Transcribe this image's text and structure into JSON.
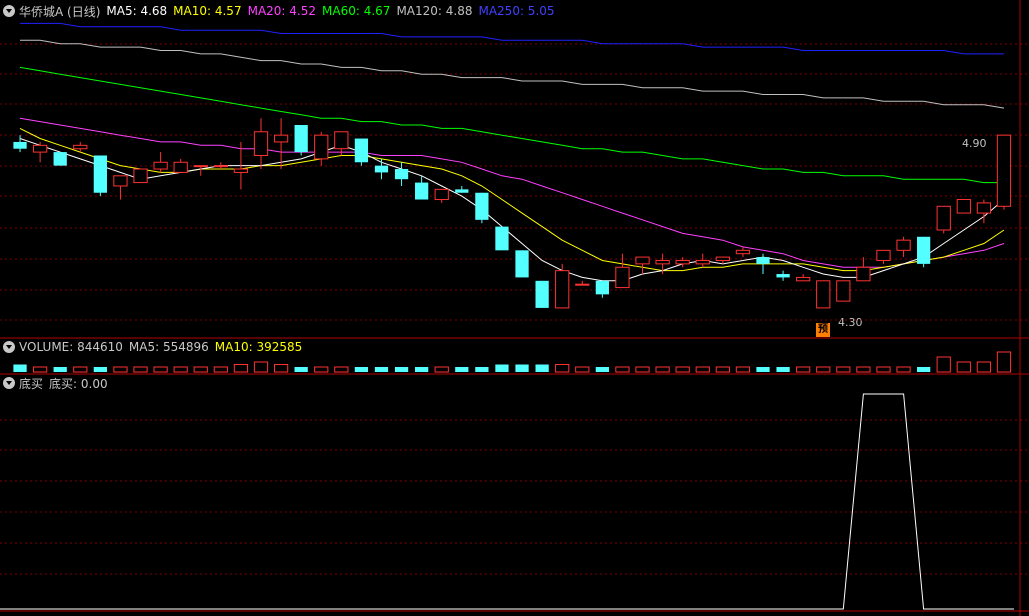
{
  "header": {
    "title": "华侨城A (日线)",
    "ma5": "MA5: 4.68",
    "ma10": "MA10: 4.57",
    "ma20": "MA20: 4.52",
    "ma60": "MA60: 4.67",
    "ma120": "MA120: 4.88",
    "ma250": "MA250: 5.05"
  },
  "volume_header": {
    "label": "VOLUME: 844610",
    "ma5": "MA5: 554896",
    "ma10": "MA10: 392585"
  },
  "indicator_header": {
    "name": "底买",
    "value": "底买: 0.00"
  },
  "annotations": {
    "high_label": "4.90",
    "low_label": "4.30",
    "flag_text": "预"
  },
  "colors": {
    "up": "#ff3232",
    "down": "#54ffff",
    "ma5": "#ffffff",
    "ma10": "#ffff00",
    "ma20": "#ff40ff",
    "ma60": "#00ff00",
    "ma120": "#c0c0c0",
    "ma250": "#2020ff",
    "grid": "#800000",
    "indicator": "#ffffff"
  },
  "chart_data": {
    "type": "candlestick",
    "ylim": [
      4.22,
      5.15
    ],
    "candles": [
      [
        4.79,
        4.81,
        4.76,
        4.77
      ],
      [
        4.76,
        4.79,
        4.73,
        4.78
      ],
      [
        4.76,
        4.76,
        4.72,
        4.72
      ],
      [
        4.77,
        4.79,
        4.76,
        4.78
      ],
      [
        4.75,
        4.75,
        4.63,
        4.64
      ],
      [
        4.66,
        4.69,
        4.62,
        4.69
      ],
      [
        4.67,
        4.71,
        4.68,
        4.71
      ],
      [
        4.71,
        4.76,
        4.7,
        4.73
      ],
      [
        4.7,
        4.74,
        4.7,
        4.73
      ],
      [
        4.72,
        4.72,
        4.69,
        4.72
      ],
      [
        4.72,
        4.73,
        4.71,
        4.72
      ],
      [
        4.7,
        4.79,
        4.65,
        4.71
      ],
      [
        4.75,
        4.86,
        4.71,
        4.82
      ],
      [
        4.79,
        4.86,
        4.71,
        4.81
      ],
      [
        4.84,
        4.84,
        4.75,
        4.76
      ],
      [
        4.74,
        4.82,
        4.72,
        4.81
      ],
      [
        4.77,
        4.8,
        4.75,
        4.82
      ],
      [
        4.8,
        4.8,
        4.72,
        4.73
      ],
      [
        4.72,
        4.74,
        4.68,
        4.7
      ],
      [
        4.71,
        4.73,
        4.66,
        4.68
      ],
      [
        4.67,
        4.69,
        4.62,
        4.62
      ],
      [
        4.62,
        4.63,
        4.61,
        4.65
      ],
      [
        4.65,
        4.66,
        4.64,
        4.64
      ],
      [
        4.64,
        4.64,
        4.55,
        4.56
      ],
      [
        4.54,
        4.54,
        4.49,
        4.47
      ],
      [
        4.47,
        4.47,
        4.39,
        4.39
      ],
      [
        4.38,
        4.38,
        4.3,
        4.3
      ],
      [
        4.3,
        4.43,
        4.3,
        4.41
      ],
      [
        4.37,
        4.38,
        4.37,
        4.37
      ],
      [
        4.38,
        4.38,
        4.33,
        4.34
      ],
      [
        4.36,
        4.46,
        4.36,
        4.42
      ],
      [
        4.43,
        4.44,
        4.4,
        4.45
      ],
      [
        4.43,
        4.46,
        4.4,
        4.44
      ],
      [
        4.43,
        4.45,
        4.42,
        4.44
      ],
      [
        4.43,
        4.46,
        4.42,
        4.44
      ],
      [
        4.44,
        4.45,
        4.43,
        4.45
      ],
      [
        4.46,
        4.48,
        4.45,
        4.47
      ],
      [
        4.45,
        4.46,
        4.4,
        4.43
      ],
      [
        4.4,
        4.41,
        4.38,
        4.39
      ],
      [
        4.38,
        4.4,
        4.38,
        4.39
      ],
      [
        4.3,
        4.33,
        4.3,
        4.38
      ],
      [
        4.32,
        4.38,
        4.32,
        4.38
      ],
      [
        4.38,
        4.45,
        4.38,
        4.42
      ],
      [
        4.44,
        4.47,
        4.43,
        4.47
      ],
      [
        4.47,
        4.51,
        4.45,
        4.5
      ],
      [
        4.51,
        4.51,
        4.42,
        4.43
      ],
      [
        4.53,
        4.6,
        4.52,
        4.6
      ],
      [
        4.58,
        4.62,
        4.58,
        4.62
      ],
      [
        4.58,
        4.62,
        4.55,
        4.61
      ],
      [
        4.6,
        4.69,
        4.59,
        4.81
      ]
    ],
    "ma5": [
      4.8,
      4.78,
      4.76,
      4.74,
      4.72,
      4.7,
      4.68,
      4.69,
      4.7,
      4.71,
      4.72,
      4.72,
      4.72,
      4.73,
      4.74,
      4.76,
      4.78,
      4.76,
      4.73,
      4.71,
      4.69,
      4.66,
      4.63,
      4.59,
      4.54,
      4.49,
      4.44,
      4.41,
      4.39,
      4.38,
      4.38,
      4.4,
      4.41,
      4.43,
      4.44,
      4.43,
      4.44,
      4.45,
      4.44,
      4.42,
      4.4,
      4.39,
      4.39,
      4.41,
      4.43,
      4.45,
      4.49,
      4.53,
      4.57,
      4.62
    ],
    "ma10": [
      4.83,
      4.8,
      4.78,
      4.76,
      4.74,
      4.72,
      4.71,
      4.7,
      4.7,
      4.71,
      4.71,
      4.71,
      4.72,
      4.72,
      4.73,
      4.74,
      4.75,
      4.75,
      4.74,
      4.73,
      4.72,
      4.71,
      4.69,
      4.66,
      4.62,
      4.58,
      4.54,
      4.5,
      4.47,
      4.44,
      4.43,
      4.42,
      4.41,
      4.41,
      4.42,
      4.42,
      4.43,
      4.43,
      4.43,
      4.43,
      4.42,
      4.41,
      4.41,
      4.42,
      4.43,
      4.44,
      4.45,
      4.47,
      4.49,
      4.53
    ],
    "ma20": [
      4.86,
      4.85,
      4.84,
      4.83,
      4.82,
      4.81,
      4.8,
      4.79,
      4.79,
      4.78,
      4.78,
      4.77,
      4.77,
      4.76,
      4.76,
      4.76,
      4.76,
      4.76,
      4.75,
      4.75,
      4.75,
      4.74,
      4.73,
      4.71,
      4.69,
      4.68,
      4.66,
      4.64,
      4.62,
      4.6,
      4.58,
      4.56,
      4.54,
      4.52,
      4.51,
      4.5,
      4.48,
      4.47,
      4.46,
      4.44,
      4.43,
      4.42,
      4.42,
      4.42,
      4.43,
      4.44,
      4.45,
      4.46,
      4.47,
      4.49
    ],
    "ma60": [
      5.01,
      5.0,
      4.99,
      4.98,
      4.97,
      4.96,
      4.95,
      4.94,
      4.93,
      4.92,
      4.91,
      4.9,
      4.89,
      4.88,
      4.87,
      4.86,
      4.86,
      4.85,
      4.85,
      4.84,
      4.84,
      4.83,
      4.83,
      4.82,
      4.81,
      4.8,
      4.79,
      4.78,
      4.77,
      4.77,
      4.76,
      4.76,
      4.75,
      4.74,
      4.74,
      4.73,
      4.72,
      4.71,
      4.71,
      4.7,
      4.7,
      4.69,
      4.69,
      4.69,
      4.68,
      4.68,
      4.68,
      4.68,
      4.67,
      4.67
    ],
    "ma120": [
      5.09,
      5.09,
      5.08,
      5.08,
      5.07,
      5.07,
      5.07,
      5.06,
      5.06,
      5.05,
      5.05,
      5.04,
      5.03,
      5.03,
      5.02,
      5.02,
      5.01,
      5.01,
      5.0,
      5.0,
      4.99,
      4.99,
      4.98,
      4.98,
      4.98,
      4.97,
      4.97,
      4.97,
      4.96,
      4.96,
      4.96,
      4.95,
      4.95,
      4.95,
      4.94,
      4.94,
      4.94,
      4.93,
      4.93,
      4.93,
      4.92,
      4.92,
      4.92,
      4.91,
      4.91,
      4.91,
      4.9,
      4.9,
      4.9,
      4.89
    ],
    "ma250": [
      5.14,
      5.14,
      5.14,
      5.13,
      5.13,
      5.13,
      5.13,
      5.13,
      5.12,
      5.12,
      5.12,
      5.12,
      5.12,
      5.11,
      5.11,
      5.11,
      5.11,
      5.11,
      5.11,
      5.1,
      5.1,
      5.1,
      5.1,
      5.1,
      5.09,
      5.09,
      5.09,
      5.09,
      5.09,
      5.08,
      5.08,
      5.08,
      5.08,
      5.08,
      5.07,
      5.07,
      5.07,
      5.07,
      5.07,
      5.06,
      5.06,
      5.06,
      5.06,
      5.06,
      5.06,
      5.06,
      5.06,
      5.05,
      5.05,
      5.05
    ],
    "volume": [
      3,
      2,
      2,
      2,
      2,
      2,
      2,
      2,
      2,
      2,
      2,
      3,
      4,
      3,
      2,
      2,
      2,
      2,
      2,
      2,
      2,
      2,
      2,
      2,
      3,
      3,
      3,
      3,
      2,
      2,
      2,
      2,
      2,
      2,
      2,
      2,
      2,
      2,
      2,
      2,
      2,
      2,
      2,
      2,
      2,
      2,
      6,
      4,
      4,
      8
    ],
    "volume_max": 8,
    "indicator": [
      0,
      0,
      0,
      0,
      0,
      0,
      0,
      0,
      0,
      0,
      0,
      0,
      0,
      0,
      0,
      0,
      0,
      0,
      0,
      0,
      0,
      0,
      0,
      0,
      0,
      0,
      0,
      0,
      0,
      0,
      0,
      0,
      0,
      0,
      0,
      0,
      0,
      0,
      0,
      0,
      0,
      0,
      1,
      1,
      1,
      0,
      0,
      0,
      0,
      0
    ]
  }
}
